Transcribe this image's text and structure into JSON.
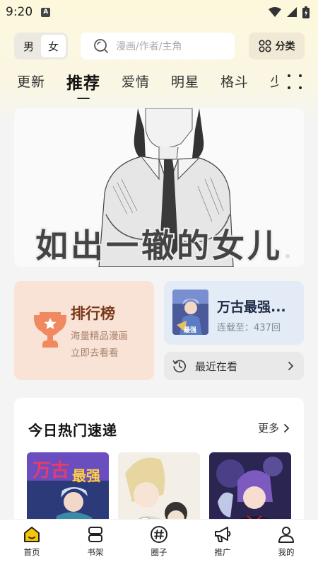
{
  "status_bar": {
    "time": "9:20",
    "notif_letter": "A"
  },
  "header": {
    "gender_options": [
      "男",
      "女"
    ],
    "gender_selected": "女",
    "search_placeholder": "漫画/作者/主角",
    "category_label": "分类"
  },
  "tabs": [
    "更新",
    "推荐",
    "爱情",
    "明星",
    "格斗",
    "少"
  ],
  "tabs_active_index": 1,
  "banner": {
    "title": "如出一辙的女儿"
  },
  "ranking": {
    "title": "排行榜",
    "line1": "海量精品漫画",
    "line2": "立即去看看"
  },
  "continue_reading": {
    "title": "万古最强...",
    "subtitle": "连载至：437回"
  },
  "recent": {
    "label": "最近在看"
  },
  "hot": {
    "title": "今日热门速递",
    "more_label": "更多"
  },
  "bottom_nav": [
    {
      "label": "首页",
      "icon": "home-icon",
      "active": true
    },
    {
      "label": "书架",
      "icon": "bookshelf-icon",
      "active": false
    },
    {
      "label": "圈子",
      "icon": "hashtag-icon",
      "active": false
    },
    {
      "label": "推广",
      "icon": "megaphone-icon",
      "active": false
    },
    {
      "label": "我的",
      "icon": "profile-icon",
      "active": false
    }
  ],
  "colors": {
    "accent_yellow": "#f7c600",
    "ranking_bg": "#f9e3d6",
    "continue_bg": "#e3ecf6",
    "trophy": "#f0895f"
  }
}
